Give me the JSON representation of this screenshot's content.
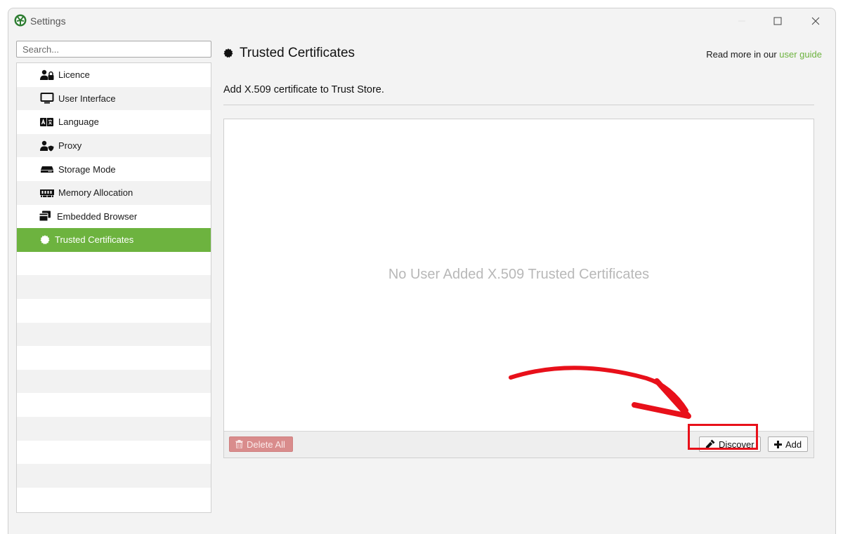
{
  "window": {
    "title": "Settings",
    "icon": "app-logo-icon"
  },
  "search": {
    "placeholder": "Search..."
  },
  "sidebar": {
    "items": [
      {
        "label": "Licence",
        "icon": "user-lock-icon",
        "active": false
      },
      {
        "label": "User Interface",
        "icon": "monitor-icon",
        "active": false
      },
      {
        "label": "Language",
        "icon": "language-icon",
        "active": false
      },
      {
        "label": "Proxy",
        "icon": "user-shield-icon",
        "active": false
      },
      {
        "label": "Storage Mode",
        "icon": "hard-drive-icon",
        "active": false
      },
      {
        "label": "Memory Allocation",
        "icon": "memory-icon",
        "active": false
      },
      {
        "label": "Embedded Browser",
        "icon": "windows-icon",
        "active": false
      },
      {
        "label": "Trusted Certificates",
        "icon": "certificate-icon",
        "active": true
      }
    ]
  },
  "main": {
    "title": "Trusted Certificates",
    "guide_prefix": "Read more in our ",
    "guide_link": "user guide",
    "subtitle": "Add X.509 certificate to Trust Store.",
    "empty_message": "No User Added X.509 Trusted Certificates",
    "buttons": {
      "delete_all": "Delete All",
      "discover": "Discover",
      "add": "Add"
    }
  },
  "colors": {
    "accent": "#6db33f",
    "delete": "#d98c8c",
    "annotation": "#e8101a"
  }
}
